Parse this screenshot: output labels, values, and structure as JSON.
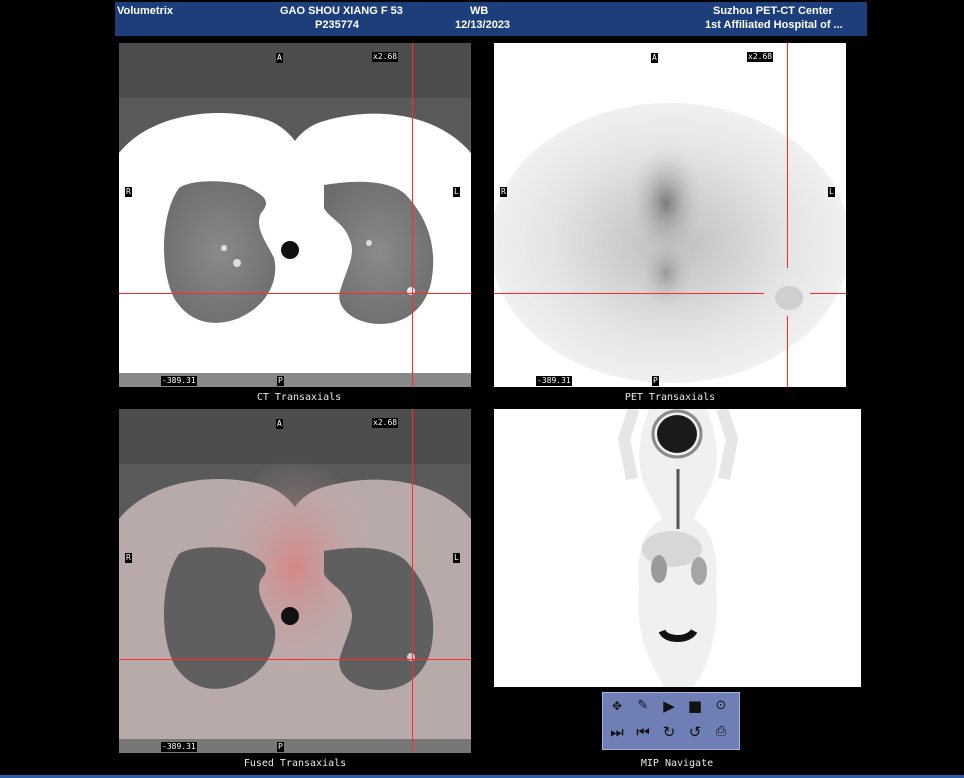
{
  "header": {
    "app": "Volumetrix",
    "patient_name": "GAO SHOU XIANG F 53",
    "patient_id": "P235774",
    "study_type": "WB",
    "study_date": "12/13/2023",
    "center": "Suzhou PET-CT Center",
    "hospital": "1st Affiliated Hospital of ..."
  },
  "viewports": {
    "ct": {
      "caption": "CT Transaxials",
      "top": "A",
      "bottom": "P",
      "left": "R",
      "right": "L",
      "zoom": "x2.68",
      "value": "-389.31"
    },
    "pet": {
      "caption": "PET Transaxials",
      "top": "A",
      "bottom": "P",
      "left": "R",
      "right": "L",
      "zoom": "x2.68",
      "value": "-389.31"
    },
    "fused": {
      "caption": "Fused Transaxials",
      "top": "A",
      "bottom": "P",
      "left": "R",
      "right": "L",
      "zoom": "x2.68",
      "value": "-389.31"
    },
    "mip": {
      "caption": "MIP Navigate"
    }
  },
  "toolbar": {
    "icons": [
      "pan-icon",
      "window-level-icon",
      "play-icon",
      "stop-icon",
      "target-icon",
      "next-frame-icon",
      "previous-frame-icon",
      "rotate-right-icon",
      "rotate-left-icon",
      "snapshot-icon"
    ]
  },
  "colors": {
    "header_bg": "#1c3f7c",
    "crosshair": "#ff2a2a",
    "toolbar_bg": "#6f7fb6"
  }
}
